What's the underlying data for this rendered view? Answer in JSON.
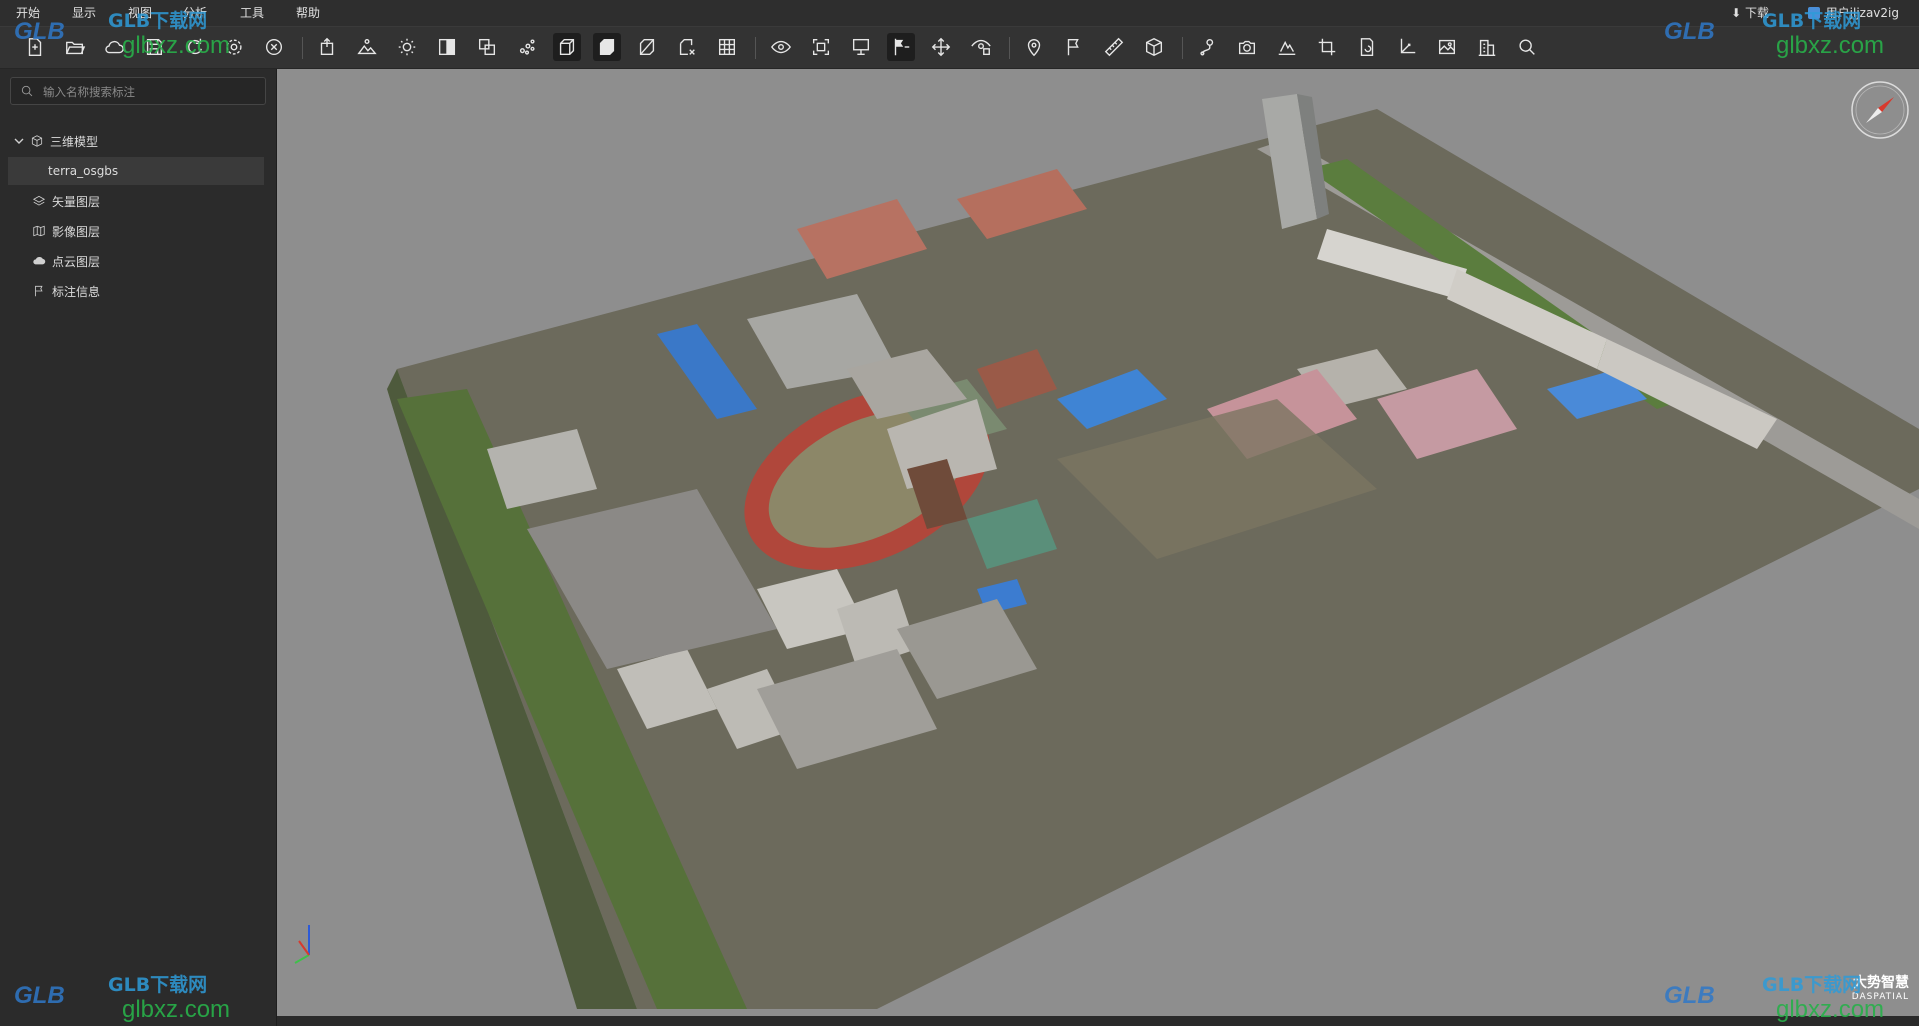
{
  "menubar": {
    "items": [
      "开始",
      "显示",
      "视图",
      "分析",
      "工具",
      "帮助"
    ],
    "download": "下载",
    "user": "用户jljzav2ig"
  },
  "sidebar": {
    "search_placeholder": "输入名称搜索标注",
    "tree": [
      {
        "label": "三维模型",
        "icon": "cube-icon",
        "expanded": true
      },
      {
        "label": "terra_osgbs",
        "icon": "",
        "selected": true
      },
      {
        "label": "矢量图层",
        "icon": "layers-icon"
      },
      {
        "label": "影像图层",
        "icon": "map-icon"
      },
      {
        "label": "点云图层",
        "icon": "cloud-points-icon"
      },
      {
        "label": "标注信息",
        "icon": "flag-icon"
      }
    ]
  },
  "toolbar": {
    "groups": [
      [
        "new-file-icon",
        "open-folder-icon",
        "cloud-icon",
        "save-icon",
        "refresh-icon",
        "settings-icon",
        "close-circle-icon"
      ],
      [
        "export-icon",
        "terrain-icon",
        "sun-icon",
        "contrast-icon",
        "layers-compare-icon",
        "particles-icon",
        "box-wire-icon",
        "box-solid-icon",
        "box-clip-icon",
        "box-remove-icon",
        "grid-icon"
      ],
      [
        "eye-rotate-icon",
        "frame-icon",
        "monitor-icon",
        "flag-toggle-icon",
        "move-icon",
        "eye-lock-icon"
      ],
      [
        "location-icon",
        "flag-line-icon",
        "ruler-icon",
        "volume-icon"
      ],
      [
        "route-icon",
        "camera-icon",
        "profile-icon",
        "crop-icon",
        "document-rotate-icon",
        "axis-icon",
        "image-icon",
        "building-icon",
        "search-icon"
      ]
    ]
  },
  "watermark": {
    "logo": "GLB",
    "cn": "GLB下载网",
    "url": "glbxz.com"
  },
  "brand": {
    "name": "大势智慧",
    "sub": "DASPATIAL"
  }
}
